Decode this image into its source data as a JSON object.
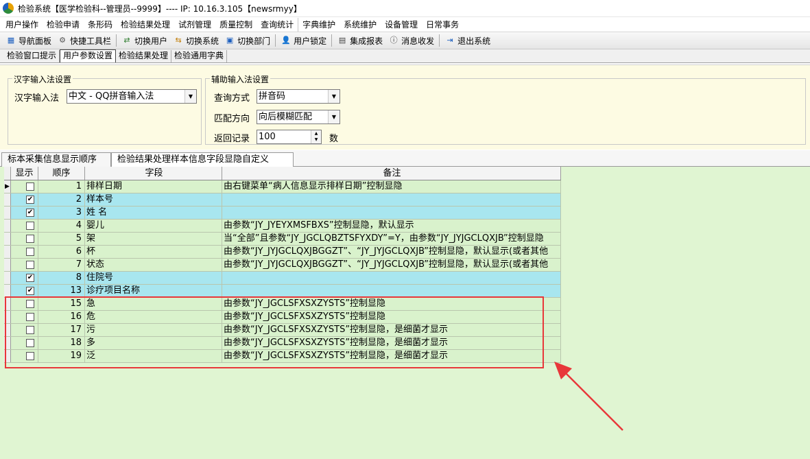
{
  "window": {
    "title": "检验系统【医学检验科--管理员--9999】---- IP:  10.16.3.105【newsrmyy】"
  },
  "menu": [
    "用户操作",
    "检验申请",
    "条形码",
    "检验结果处理",
    "试剂管理",
    "质量控制",
    "查询统计",
    "字典维护",
    "系统维护",
    "设备管理",
    "日常事务"
  ],
  "toolbar": {
    "nav_panel": "导航面板",
    "quick_bar": "快捷工具栏",
    "switch_user": "切换用户",
    "switch_system": "切换系统",
    "switch_dept": "切换部门",
    "user_lock": "用户锁定",
    "integrated_report": "集成报表",
    "messages": "消息收发",
    "exit": "退出系统"
  },
  "doc_tabs": [
    "检验窗口提示",
    "用户参数设置",
    "检验结果处理",
    "检验通用字典"
  ],
  "chinese_ime": {
    "legend": "汉字输入法设置",
    "label": "汉字输入法",
    "value": "中文 - QQ拼音输入法"
  },
  "aux_ime": {
    "legend": "辅助输入法设置",
    "query_label": "查询方式",
    "query_value": "拼音码",
    "match_label": "匹配方向",
    "match_value": "向后模糊匹配",
    "return_label": "返回记录",
    "return_value": "100",
    "return_unit": "数"
  },
  "grid_tabs": [
    "标本采集信息显示顺序",
    "检验结果处理样本信息字段显隐自定义"
  ],
  "grid": {
    "headers": {
      "show": "显示",
      "order": "顺序",
      "field": "字段",
      "note": "备注"
    },
    "rows": [
      {
        "checked": false,
        "order": "1",
        "field": "排样日期",
        "note": "由右键菜单“病人信息显示排样日期”控制显隐",
        "color": "green",
        "current": true
      },
      {
        "checked": true,
        "order": "2",
        "field": "样本号",
        "note": "",
        "color": "blue"
      },
      {
        "checked": true,
        "order": "3",
        "field": "姓 名",
        "note": "",
        "color": "blue"
      },
      {
        "checked": false,
        "order": "4",
        "field": "婴儿",
        "note": "由参数“JY_JYEYXMSFBXS”控制显隐，默认显示",
        "color": "green"
      },
      {
        "checked": false,
        "order": "5",
        "field": "架",
        "note": "当“全部”且参数“JY_JGCLQBZTSFYXDY”=Y，由参数“JY_JYJGCLQXJB”控制显隐",
        "color": "green"
      },
      {
        "checked": false,
        "order": "6",
        "field": "杯",
        "note": "由参数“JY_JYJGCLQXJBGGZT”、“JY_JYJGCLQXJB”控制显隐，默认显示(或者其他",
        "color": "green"
      },
      {
        "checked": false,
        "order": "7",
        "field": "状态",
        "note": "由参数“JY_JYJGCLQXJBGGZT”、“JY_JYJGCLQXJB”控制显隐，默认显示(或者其他",
        "color": "green"
      },
      {
        "checked": true,
        "order": "8",
        "field": "住院号",
        "note": "",
        "color": "blue"
      },
      {
        "checked": true,
        "order": "13",
        "field": "诊疗项目名称",
        "note": "",
        "color": "blue"
      },
      {
        "checked": false,
        "order": "15",
        "field": "急",
        "note": "由参数“JY_JGCLSFXSXZYSTS”控制显隐",
        "color": "green"
      },
      {
        "checked": false,
        "order": "16",
        "field": "危",
        "note": "由参数“JY_JGCLSFXSXZYSTS”控制显隐",
        "color": "green"
      },
      {
        "checked": false,
        "order": "17",
        "field": "污",
        "note": "由参数“JY_JGCLSFXSXZYSTS”控制显隐，是细菌才显示",
        "color": "green"
      },
      {
        "checked": false,
        "order": "18",
        "field": "多",
        "note": "由参数“JY_JGCLSFXSXZYSTS”控制显隐，是细菌才显示",
        "color": "green"
      },
      {
        "checked": false,
        "order": "19",
        "field": "泛",
        "note": "由参数“JY_JGCLSFXSXZYSTS”控制显隐，是细菌才显示",
        "color": "green"
      }
    ]
  },
  "colors": {
    "highlight_box": "#e8373a",
    "row_blue": "#a8e6ef",
    "row_green": "#d9f2cc",
    "grid_bg": "#e0f5d2"
  }
}
